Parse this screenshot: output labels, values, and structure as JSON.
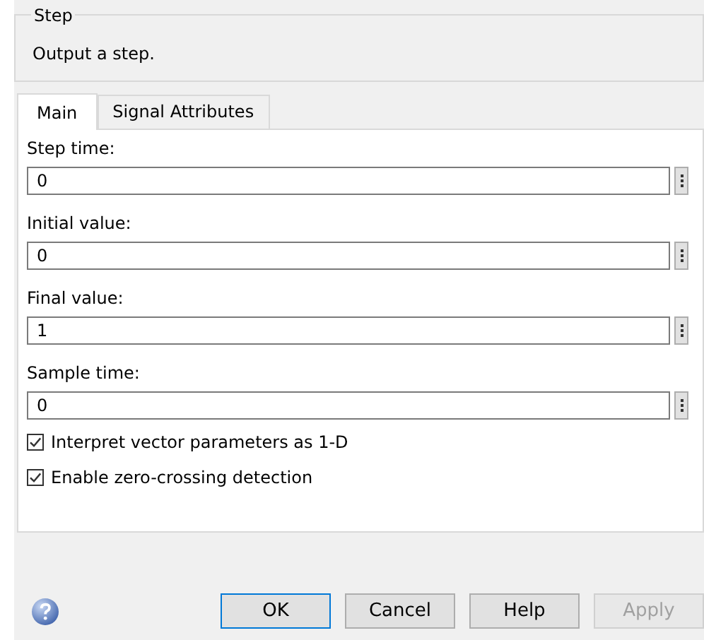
{
  "group": {
    "title": "Step",
    "description": "Output a step."
  },
  "tabs": [
    {
      "label": "Main",
      "selected": true
    },
    {
      "label": "Signal Attributes",
      "selected": false
    }
  ],
  "parameters": [
    {
      "label": "Step time:",
      "value": "0"
    },
    {
      "label": "Initial value:",
      "value": "0"
    },
    {
      "label": "Final value:",
      "value": "1"
    },
    {
      "label": "Sample time:",
      "value": "0"
    }
  ],
  "options": [
    {
      "label": "Interpret vector parameters as 1-D",
      "checked": true
    },
    {
      "label": "Enable zero-crossing detection",
      "checked": true
    }
  ],
  "buttons": [
    {
      "label": "OK",
      "kind": "default",
      "disabled": false
    },
    {
      "label": "Cancel",
      "kind": "normal",
      "disabled": false
    },
    {
      "label": "Help",
      "kind": "normal",
      "disabled": false
    },
    {
      "label": "Apply",
      "kind": "normal",
      "disabled": true
    }
  ]
}
